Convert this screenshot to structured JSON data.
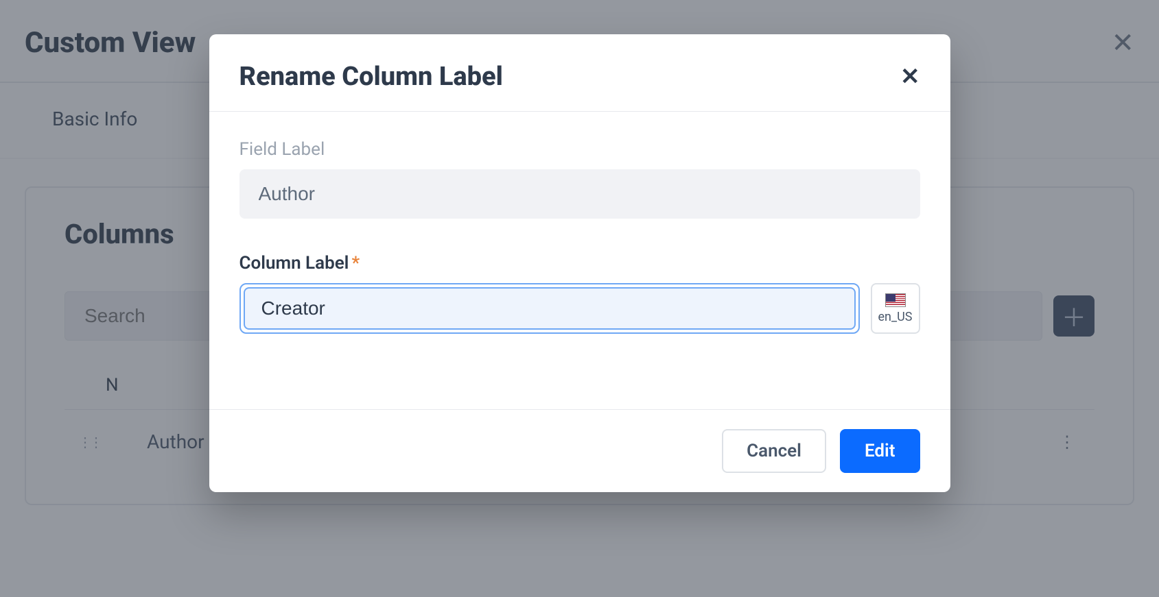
{
  "page": {
    "title": "Custom View",
    "tabs": {
      "basic_info": "Basic Info"
    },
    "columns_section_title": "Columns",
    "search_placeholder": "Search",
    "table": {
      "head_col1": "N",
      "head_col2": "",
      "row1": {
        "name": "Author",
        "label": "Author"
      }
    }
  },
  "modal": {
    "title": "Rename Column Label",
    "field_label_caption": "Field Label",
    "field_label_value": "Author",
    "column_label_caption": "Column Label",
    "column_label_value": "Creator",
    "locale": "en_US",
    "cancel": "Cancel",
    "edit": "Edit"
  }
}
